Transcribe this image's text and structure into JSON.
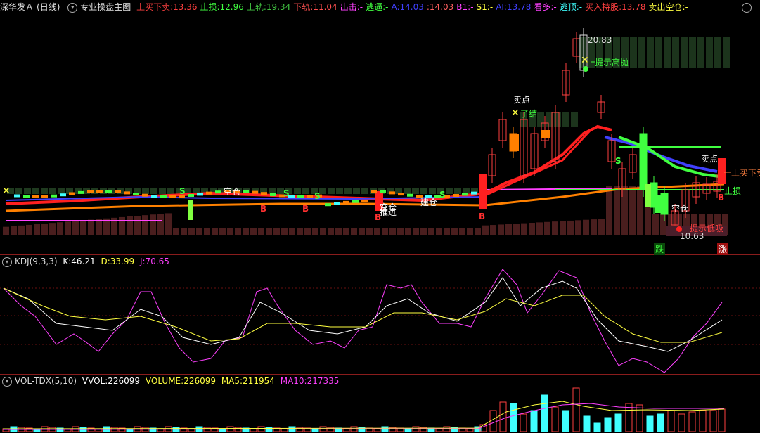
{
  "main": {
    "stock": "深华发Ａ",
    "period": "(日线)",
    "indicator": "专业操盘主图",
    "fields": [
      {
        "label": "上买下卖:",
        "value": "13.36",
        "color": "#ff4040"
      },
      {
        "label": "止损:",
        "value": "12.96",
        "color": "#40ff40"
      },
      {
        "label": "上轨:",
        "value": "19.34",
        "color": "#40c040"
      },
      {
        "label": "下轨:",
        "value": "11.04",
        "color": "#ff5050"
      },
      {
        "label": "出击:",
        "value": "-",
        "color": "#ff40ff"
      },
      {
        "label": "逃逼:",
        "value": "-",
        "color": "#40ff40"
      },
      {
        "label": "A:",
        "value": "14.03",
        "color": "#4040ff"
      },
      {
        "label": ":",
        "value": "14.03",
        "color": "#ff6060"
      },
      {
        "label": "B1:",
        "value": "-",
        "color": "#ff40ff"
      },
      {
        "label": "S1:",
        "value": "-",
        "color": "#ffff40"
      },
      {
        "label": "AI:",
        "value": "13.78",
        "color": "#4040ff"
      },
      {
        "label": "看多:",
        "value": "-",
        "color": "#ff40ff"
      },
      {
        "label": "逃顶:",
        "value": "-",
        "color": "#40ffff"
      },
      {
        "label": "买入持股:",
        "value": "13.78",
        "color": "#ff4040"
      },
      {
        "label": "卖出空仓:",
        "value": "-",
        "color": "#ffff40"
      }
    ],
    "annotations": {
      "high_price": "20.83",
      "low_price": "10.63",
      "hint_high": "提示高抛",
      "hint_low": "提示低吸",
      "sell_point": "卖点",
      "sell_point2": "卖点",
      "end": "了结",
      "empty": "空仓",
      "empty2": "空仓",
      "empty3": "空仓",
      "build": "建仓",
      "push": "推进",
      "buy_sell_tag": "上买下卖",
      "stop_tag": "止损",
      "fall": "跌",
      "rise": "涨",
      "s_marks": [
        "S",
        "S",
        "S",
        "S",
        "S"
      ],
      "b_marks": [
        "B",
        "B",
        "B",
        "B",
        "B"
      ]
    }
  },
  "kdj": {
    "name": "KDJ(9,3,3)",
    "k_label": "K:",
    "k_value": "46.21",
    "d_label": "D:",
    "d_value": "33.99",
    "j_label": "J:",
    "j_value": "70.65",
    "colors": {
      "k": "#ffffff",
      "d": "#ffff40",
      "j": "#ff40ff"
    }
  },
  "vol": {
    "name": "VOL-TDX(5,10)",
    "vvol_label": "VVOL:",
    "vvol_value": "226099",
    "volume_label": "VOLUME:",
    "volume_value": "226099",
    "ma5_label": "MA5:",
    "ma5_value": "211954",
    "ma10_label": "MA10:",
    "ma10_value": "217335",
    "colors": {
      "volume": "#ffff40",
      "ma5": "#ffff40",
      "ma10": "#ff40ff"
    }
  },
  "colors": {
    "up": "#ff4040",
    "down": "#40ffff",
    "grid": "#8a1c1c"
  }
}
